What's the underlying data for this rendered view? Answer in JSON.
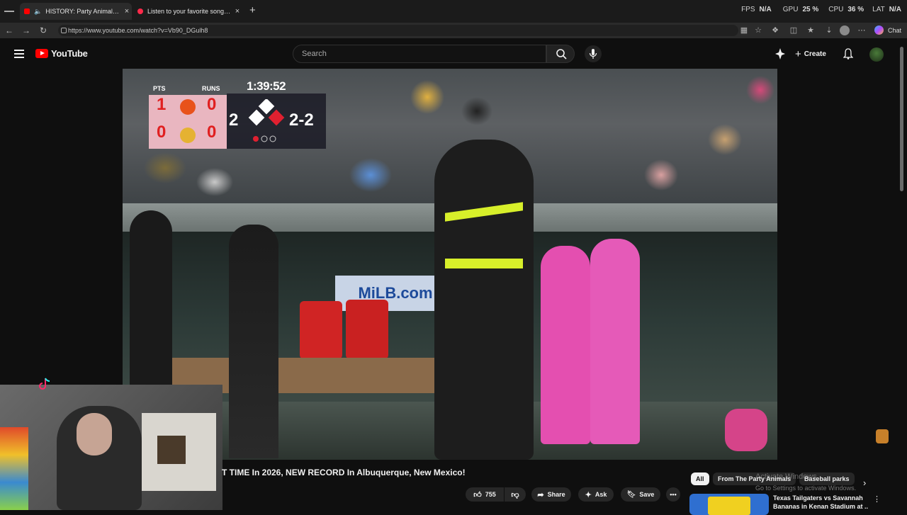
{
  "browser": {
    "tabs": [
      {
        "label": "HISTORY: Party Animals & Fir",
        "close": "×"
      },
      {
        "label": "Listen to your favorite songs and d",
        "close": "×"
      }
    ],
    "new_tab": "+",
    "url": "https://www.youtube.com/watch?v=Vb90_DGulh8",
    "chat_label": "Chat",
    "overlay_stats": {
      "fps_label": "FPS",
      "fps_value": "N/A",
      "gpu_label": "GPU",
      "gpu_value": "25 %",
      "cpu_label": "CPU",
      "cpu_value": "36 %",
      "lat_label": "LAT",
      "lat_value": "N/A"
    }
  },
  "youtube": {
    "logo_text": "YouTube",
    "search_placeholder": "Search",
    "create_label": "Create"
  },
  "scoreboard": {
    "pts_label": "PTS",
    "runs_label": "RUNS",
    "clock": "1:39:52",
    "home_pts": "1",
    "home_runs": "0",
    "away_pts": "0",
    "away_runs": "0",
    "inning": "2",
    "count": "2-2"
  },
  "video": {
    "title": "T TIME In 2026, NEW RECORD In Albuquerque, New Mexico!",
    "like_count": "755",
    "share_label": "Share",
    "ask_label": "Ask",
    "save_label": "Save",
    "more_label": "•••"
  },
  "recommendations": {
    "chips": [
      "All",
      "From The Party Animals",
      "Baseball parks"
    ],
    "watermark_line1": "Activate Windows",
    "watermark_line2": "Go to Settings to activate Windows.",
    "first_title_line1": "Texas Tailgaters vs Savannah",
    "first_title_line2": "Bananas in Kenan Stadium at ..."
  },
  "colors": {
    "brand_red": "#ff0000",
    "background": "#0f0f0f",
    "pill": "#272727"
  }
}
